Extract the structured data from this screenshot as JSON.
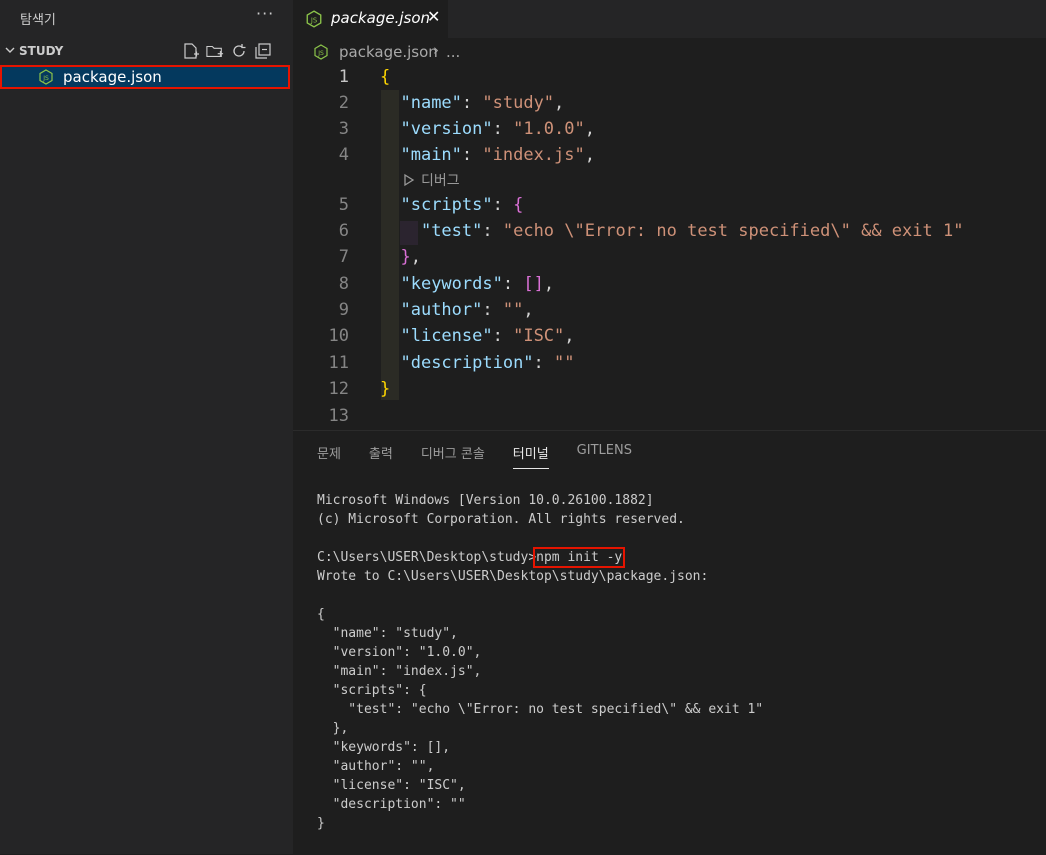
{
  "sidebar": {
    "title": "탐색기",
    "more": "···",
    "section": "STUDY",
    "file": "package.json"
  },
  "editor": {
    "tab_label": "package.json",
    "tab_close": "✕",
    "breadcrumb_file": "package.json",
    "breadcrumb_sep": "›",
    "breadcrumb_more": "...",
    "codelens_label": "디버그",
    "line_numbers": [
      "1",
      "2",
      "3",
      "4",
      "5",
      "6",
      "7",
      "8",
      "9",
      "10",
      "11",
      "12",
      "13"
    ],
    "lines": {
      "l1_open": "{",
      "name_key": "\"name\"",
      "name_val": "\"study\"",
      "version_key": "\"version\"",
      "version_val": "\"1.0.0\"",
      "main_key": "\"main\"",
      "main_val": "\"index.js\"",
      "scripts_key": "\"scripts\"",
      "scripts_open": "{",
      "test_key": "\"test\"",
      "test_val": "\"echo \\\"Error: no test specified\\\" && exit 1\"",
      "scripts_close": "}",
      "keywords_key": "\"keywords\"",
      "keywords_val": "[]",
      "author_key": "\"author\"",
      "author_val": "\"\"",
      "license_key": "\"license\"",
      "license_val": "\"ISC\"",
      "description_key": "\"description\"",
      "description_val": "\"\"",
      "l12_close": "}"
    }
  },
  "panel": {
    "tabs": [
      "문제",
      "출력",
      "디버그 콘솔",
      "터미널",
      "GITLENS"
    ],
    "active_tab_index": 3,
    "terminal": {
      "line1": "Microsoft Windows [Version 10.0.26100.1882]",
      "line2": "(c) Microsoft Corporation. All rights reserved.",
      "prompt": "C:\\Users\\USER\\Desktop\\study>",
      "command": "npm init -y",
      "wrote": "Wrote to C:\\Users\\USER\\Desktop\\study\\package.json:",
      "json_lines": [
        "{",
        "  \"name\": \"study\",",
        "  \"version\": \"1.0.0\",",
        "  \"main\": \"index.js\",",
        "  \"scripts\": {",
        "    \"test\": \"echo \\\"Error: no test specified\\\" && exit 1\"",
        "  },",
        "  \"keywords\": [],",
        "  \"author\": \"\",",
        "  \"license\": \"ISC\",",
        "  \"description\": \"\"",
        "}"
      ]
    }
  },
  "colors": {
    "selection": "#04395e",
    "highlight_box": "#e51400",
    "js_icon": "#8bc34a",
    "key": "#9cdcfe",
    "string": "#ce9178",
    "bracket1": "#ffd700",
    "bracket2": "#da70d6"
  }
}
